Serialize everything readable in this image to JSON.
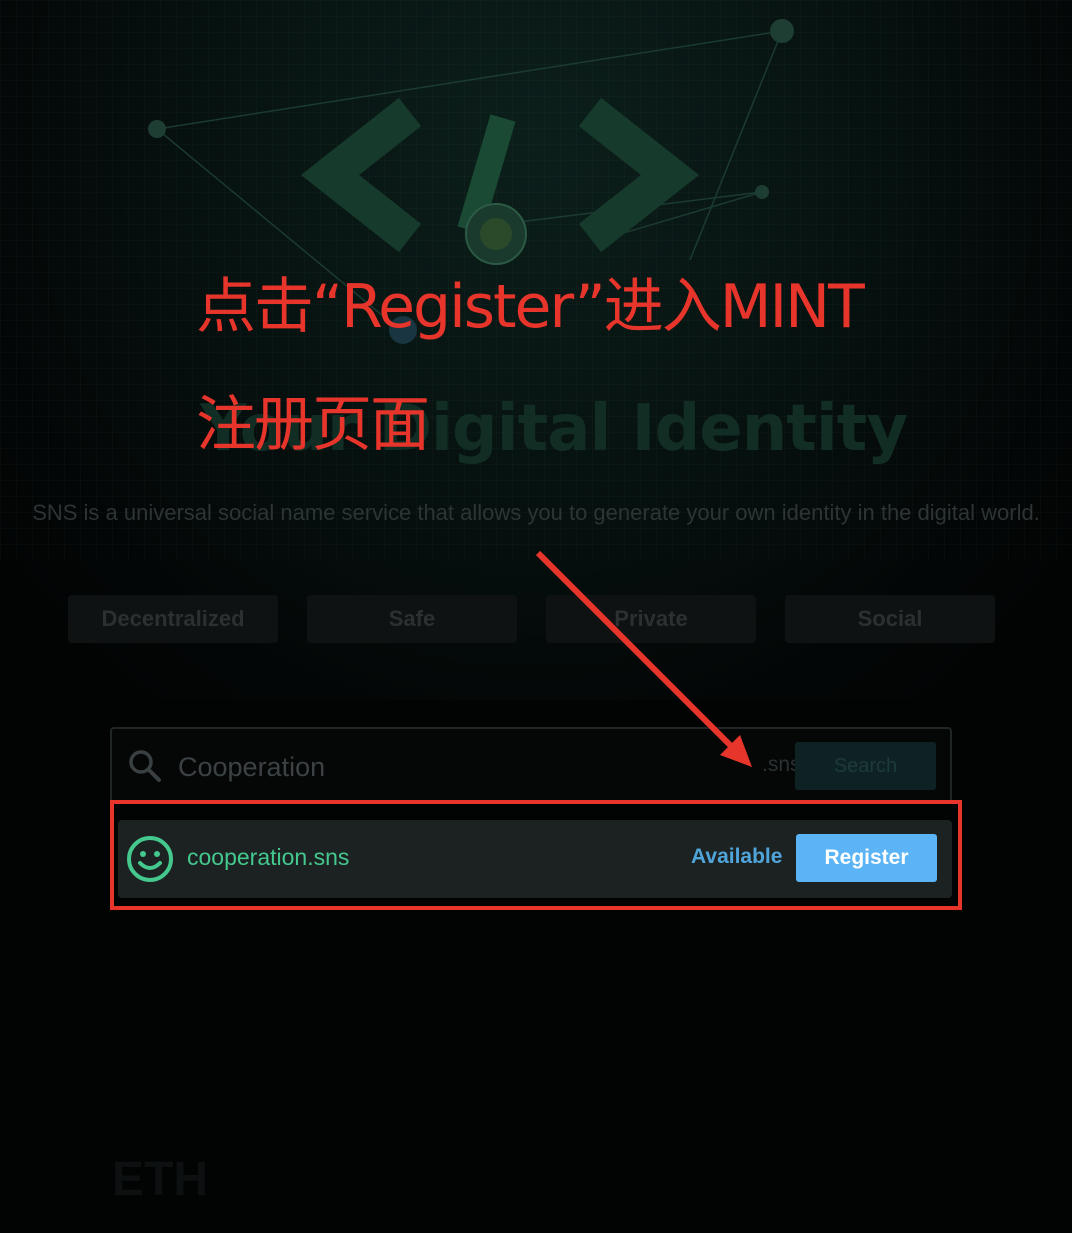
{
  "hero": {
    "headline": "Your Digital Identity",
    "subtitle": "SNS is a universal social name service that allows you to generate your own identity in the digital world.",
    "features": [
      "Decentralized",
      "Safe",
      "Private",
      "Social"
    ]
  },
  "search": {
    "value": "Cooperation",
    "suffix": ".sns",
    "button_label": "Search"
  },
  "result": {
    "domain": "cooperation.sns",
    "status": "Available",
    "register_label": "Register"
  },
  "footer": {
    "chain": "ETH"
  },
  "annotation": {
    "line1": "点击“Register”进入MINT",
    "line2": "注册页面"
  },
  "colors": {
    "annotation_red": "#e8352b",
    "register_button": "#5ab4f5",
    "domain_green": "#44c88e",
    "status_blue": "#4fa4d9"
  }
}
